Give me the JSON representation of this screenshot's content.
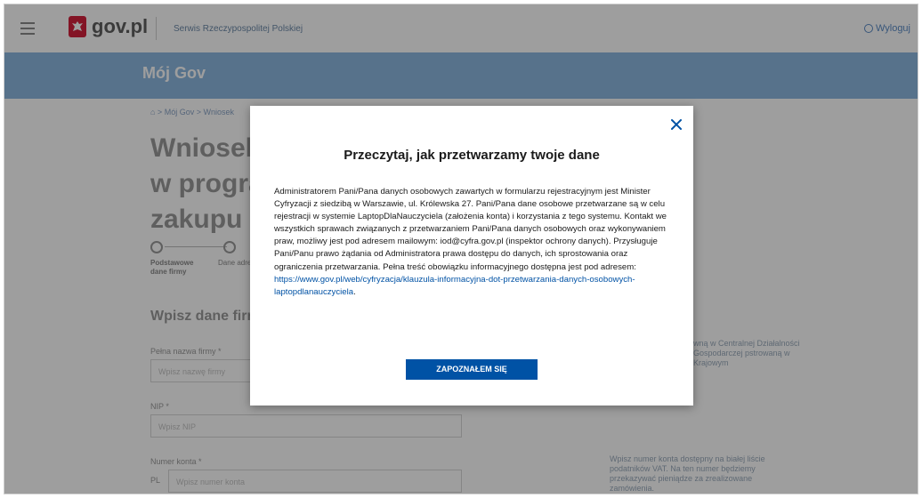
{
  "header": {
    "logo_text": "gov.pl",
    "service": "Serwis Rzeczypospolitej Polskiej",
    "logout": "Wyloguj"
  },
  "bluebar": {
    "title": "Mój Gov"
  },
  "page": {
    "breadcrumb": "⌂  >  Mój Gov  >  Wniosek",
    "heading_lines": [
      "Wniosek",
      "w progra",
      "zakupu l"
    ],
    "steps": [
      {
        "label": "Podstawowe dane firmy"
      },
      {
        "label": "Dane adreso"
      }
    ],
    "section_title": "Wpisz dane firr",
    "fields": {
      "company_label": "Pełna nazwa firmy *",
      "company_placeholder": "Wpisz nazwę firmy",
      "nip_label": "NIP *",
      "nip_placeholder": "Wpisz NIP",
      "account_label": "Numer konta *",
      "account_prefix": "PL",
      "account_placeholder": "Wpisz numer konta"
    },
    "side_notes": {
      "note1": "wną w Centralnej Działalności Gospodarczej pstrowaną w Krajowym",
      "note2": "Wpisz numer konta dostępny na białej liście podatników VAT. Na ten numer będziemy przekazywać pieniądze za zrealizowane zamówienia."
    }
  },
  "modal": {
    "title": "Przeczytaj, jak przetwarzamy twoje dane",
    "body": "Administratorem Pani/Pana danych osobowych zawartych w formularzu rejestracyjnym jest Minister Cyfryzacji z siedzibą w Warszawie, ul. Królewska 27. Pani/Pana dane osobowe przetwarzane są w celu rejestracji w systemie LaptopDlaNauczyciela (założenia konta) i korzystania z tego systemu. Kontakt we wszystkich sprawach związanych z przetwarzaniem Pani/Pana danych osobowych oraz wykonywaniem praw, możliwy jest pod adresem mailowym: iod@cyfra.gov.pl (inspektor ochrony danych). Przysługuje Pani/Panu prawo żądania od Administratora prawa dostępu do danych, ich sprostowania oraz ograniczenia przetwarzania. Pełna treść obowiązku informacyjnego dostępna jest pod adresem: ",
    "link": "https://www.gov.pl/web/cyfryzacja/klauzula-informacyjna-dot-przetwarzania-danych-osobowych-laptopdlanauczyciela",
    "link_suffix": ".",
    "accept_label": "ZAPOZNAŁEM SIĘ"
  }
}
